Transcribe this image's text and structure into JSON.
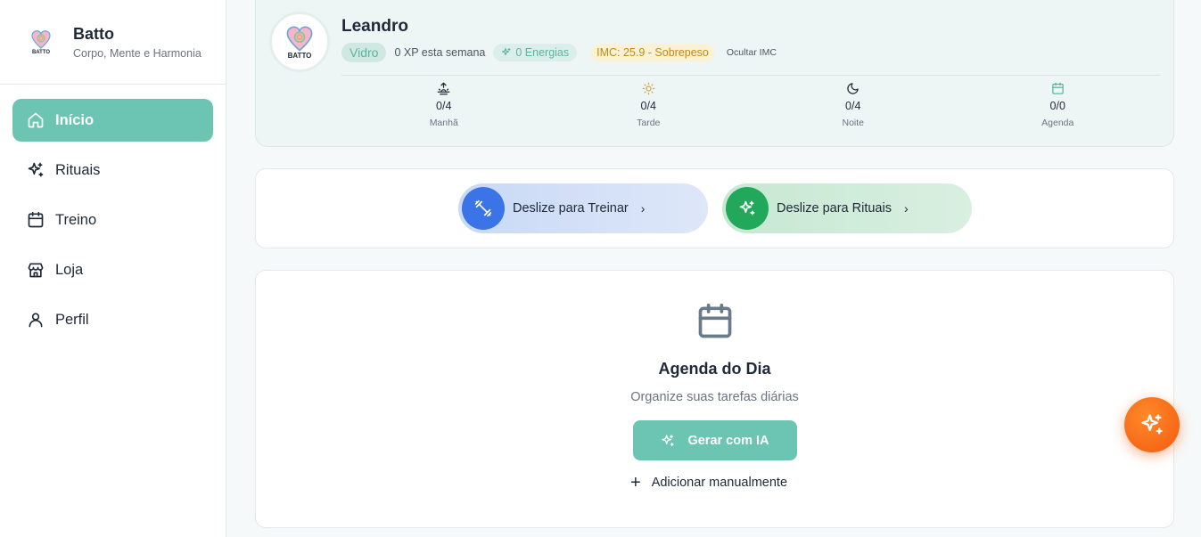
{
  "brand": {
    "name": "Batto",
    "tagline": "Corpo, Mente e Harmonia",
    "logo_text": "BATTO"
  },
  "nav": {
    "items": [
      {
        "label": "Início",
        "icon": "home-icon",
        "active": true
      },
      {
        "label": "Rituais",
        "icon": "sparkles-icon",
        "active": false
      },
      {
        "label": "Treino",
        "icon": "calendar-icon",
        "active": false
      },
      {
        "label": "Loja",
        "icon": "store-icon",
        "active": false
      },
      {
        "label": "Perfil",
        "icon": "user-icon",
        "active": false
      }
    ]
  },
  "profile": {
    "name": "Leandro",
    "level": "Vidro",
    "xp": "0 XP esta semana",
    "energy": "0 Energias",
    "imc": "IMC: 25.9 - Sobrepeso",
    "hide_imc": "Ocultar IMC",
    "periods": [
      {
        "count": "0/4",
        "label": "Manhã",
        "icon": "sunrise-icon"
      },
      {
        "count": "0/4",
        "label": "Tarde",
        "icon": "sun-icon"
      },
      {
        "count": "0/4",
        "label": "Noite",
        "icon": "moon-icon"
      },
      {
        "count": "0/0",
        "label": "Agenda",
        "icon": "calendar-icon"
      }
    ]
  },
  "swipes": {
    "train": "Deslize para Treinar",
    "ritual": "Deslize para Rituais"
  },
  "agenda": {
    "title": "Agenda do Dia",
    "subtitle": "Organize suas tarefas diárias",
    "ai_button": "Gerar com IA",
    "manual": "Adicionar manualmente"
  },
  "colors": {
    "accent": "#6cc5b2",
    "train": "#3b74e6",
    "ritual": "#22a85a",
    "fab": "#f25a10",
    "imc": "#c48a10"
  }
}
